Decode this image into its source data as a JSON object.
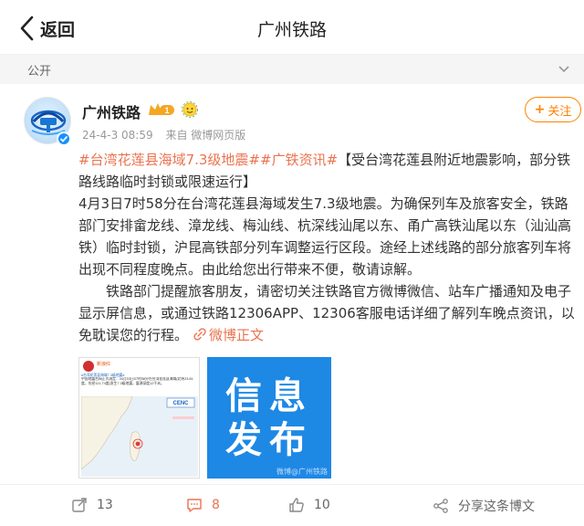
{
  "navbar": {
    "back_label": "返回",
    "title": "广州铁路"
  },
  "visibility": {
    "label": "公开"
  },
  "post": {
    "author": "广州铁路",
    "vip_level": "1",
    "date": "24-4-3 08:59",
    "source": "来自 微博网页版",
    "follow_label": "关注",
    "topics": [
      "#台湾花莲县海域7.3级地震#",
      "#广铁资讯#"
    ],
    "headline": "【受台湾花莲县附近地震影响，部分铁路线路临时封锁或限速运行】",
    "paragraph1": "4月3日7时58分在台湾花莲县海域发生7.3级地震。为确保列车及旅客安全，铁路部门安排畲龙线、漳龙线、梅汕线、杭深线汕尾以东、甬广高铁汕尾以东（汕汕高铁）临时封锁，沪昆高铁部分列车调整运行区段。途经上述线路的部分旅客列车将出现不同程度晚点。由此给您出行带来不便，敬请谅解。",
    "paragraph2": "铁路部门提醒旅客朋友，请密切关注铁路官方微博微信、站车广播通知及电子显示屏信息，或通过铁路12306APP、12306客服电话详细了解列车晚点资讯，以免耽误您的行程。",
    "read_full_label": "微博正文",
    "image1": {
      "author": "新浪红",
      "topic": "#台湾花莲县海域7.3级地震#",
      "text": "中国地震台网正式测定：04月03日07时58分在台湾花莲县海域(北纬23.81度，东经121.74度)发生7.3级地震，震源深度12千米。",
      "logo": "CENC"
    },
    "image2": {
      "line1": "信息",
      "line2": "发布",
      "watermark": "微博@广州铁路"
    }
  },
  "actions": {
    "repost_count": "13",
    "comment_count": "8",
    "like_count": "10",
    "share_label": "分享这条博文"
  },
  "colors": {
    "accent": "#eb7350",
    "follow": "#ff8200",
    "info_blue": "#1e88e5"
  }
}
